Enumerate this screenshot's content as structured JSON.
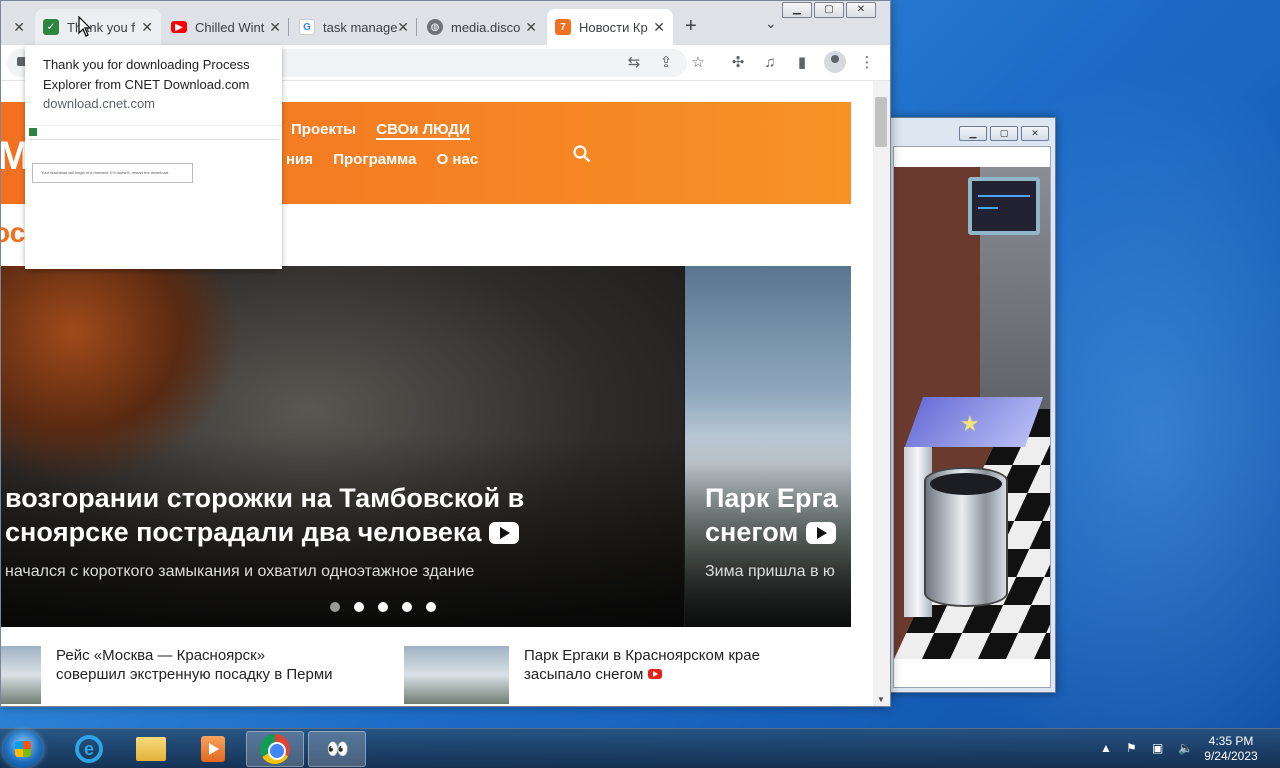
{
  "browser": {
    "tabs": [
      {
        "title": "Thank you f",
        "favicon": "cnet-download-icon",
        "color": "#2e8540"
      },
      {
        "title": "Chilled Wint",
        "favicon": "youtube-icon",
        "color": "#ff0000"
      },
      {
        "title": "task manage",
        "favicon": "google-icon",
        "color": "#4285f4"
      },
      {
        "title": "media.disco",
        "favicon": "globe-icon",
        "color": "#5f6368"
      },
      {
        "title": "Новости Кр",
        "favicon": "site-7-icon",
        "color": "#f37021"
      }
    ],
    "hovercard": {
      "title": "Thank you for downloading Process Explorer from CNET Download.com",
      "domain": "download.cnet.com",
      "preview_message": "Your download will begin in a moment. If it doesn't, restart the download."
    }
  },
  "site": {
    "nav_row1": [
      "Проекты",
      "СВОи ЛЮДИ"
    ],
    "nav_row2": [
      "ния",
      "Программа",
      "О нас"
    ],
    "logo_fragment": "МС",
    "section_title": "ос                  и края",
    "slides": [
      {
        "title_line1": "возгорании сторожки на Тамбовской в",
        "title_line2": "снoярске пострадали два человека",
        "desc": "начался с короткого замыкания и охватил одноэтажное здание"
      },
      {
        "title_line1": "Парк Ерга",
        "title_line2": "снегом",
        "desc": "Зима пришла в ю"
      }
    ],
    "news": [
      {
        "text": "Рейс «Москва — Красноярск» совершил экстренную посадку в Перми"
      },
      {
        "text": "Парк Ергаки в Красноярском крае засыпало снегом"
      }
    ]
  },
  "taskbar": {
    "time": "4:35 PM",
    "date": "9/24/2023"
  },
  "colors": {
    "brand_orange": "#f37021",
    "taskbar": "#1e3a5c"
  }
}
